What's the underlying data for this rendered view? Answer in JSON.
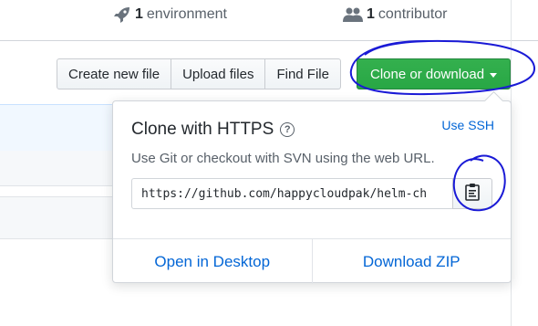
{
  "stats": {
    "environment": {
      "count": "1",
      "label": "environment",
      "icon": "rocket-icon"
    },
    "contributor": {
      "count": "1",
      "label": "contributor",
      "icon": "people-icon"
    }
  },
  "toolbar": {
    "create_new_file": "Create new file",
    "upload_files": "Upload files",
    "find_file": "Find File",
    "clone_or_download": "Clone or download"
  },
  "clone_panel": {
    "title": "Clone with HTTPS",
    "help_icon": "question-circle-icon",
    "use_ssh": "Use SSH",
    "description": "Use Git or checkout with SVN using the web URL.",
    "url": "https://github.com/happycloudpak/helm-ch",
    "copy_icon": "clipboard-icon",
    "open_in_desktop": "Open in Desktop",
    "download_zip": "Download ZIP"
  },
  "colors": {
    "accent_green": "#28a745",
    "link_blue": "#0366d6",
    "annotation_ink": "#1a1ad6"
  }
}
